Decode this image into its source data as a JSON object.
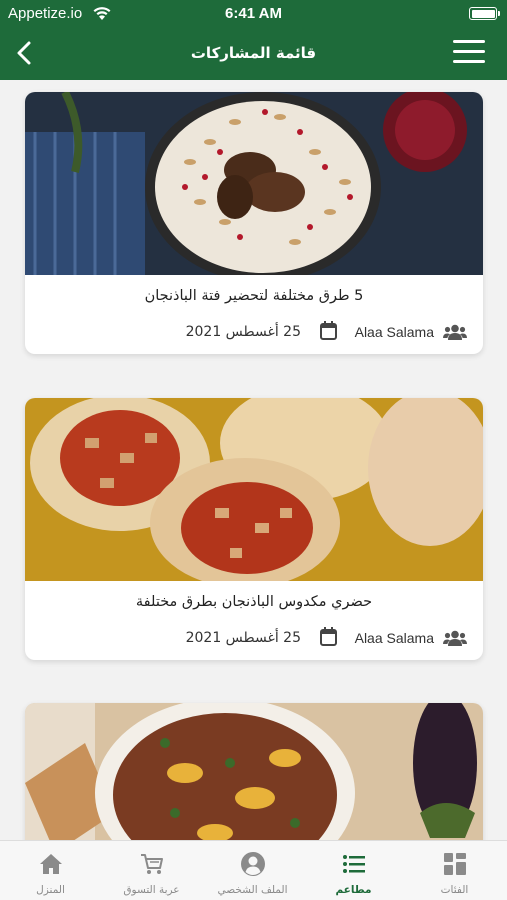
{
  "status_bar": {
    "carrier": "Appetize.io",
    "time": "6:41 AM"
  },
  "header": {
    "title": "قائمة المشاركات"
  },
  "posts": [
    {
      "title": "5 طرق مختلفة لتحضير فتة الباذنجان",
      "author": "Alaa Salama",
      "date": "25 أغسطس 2021"
    },
    {
      "title": "حضري مكدوس الباذنجان بطرق مختلفة",
      "author": "Alaa Salama",
      "date": "25 أغسطس 2021"
    }
  ],
  "tabs": [
    {
      "label": "المنزل",
      "icon": "home-icon",
      "active": false
    },
    {
      "label": "عربة التسوق",
      "icon": "cart-icon",
      "active": false
    },
    {
      "label": "الملف الشخصي",
      "icon": "profile-icon",
      "active": false
    },
    {
      "label": "مطاعم",
      "icon": "list-icon",
      "active": true
    },
    {
      "label": "الفئات",
      "icon": "categories-icon",
      "active": false
    }
  ],
  "colors": {
    "brand": "#1e6b3a",
    "tab_inactive": "#8a8a8a"
  }
}
